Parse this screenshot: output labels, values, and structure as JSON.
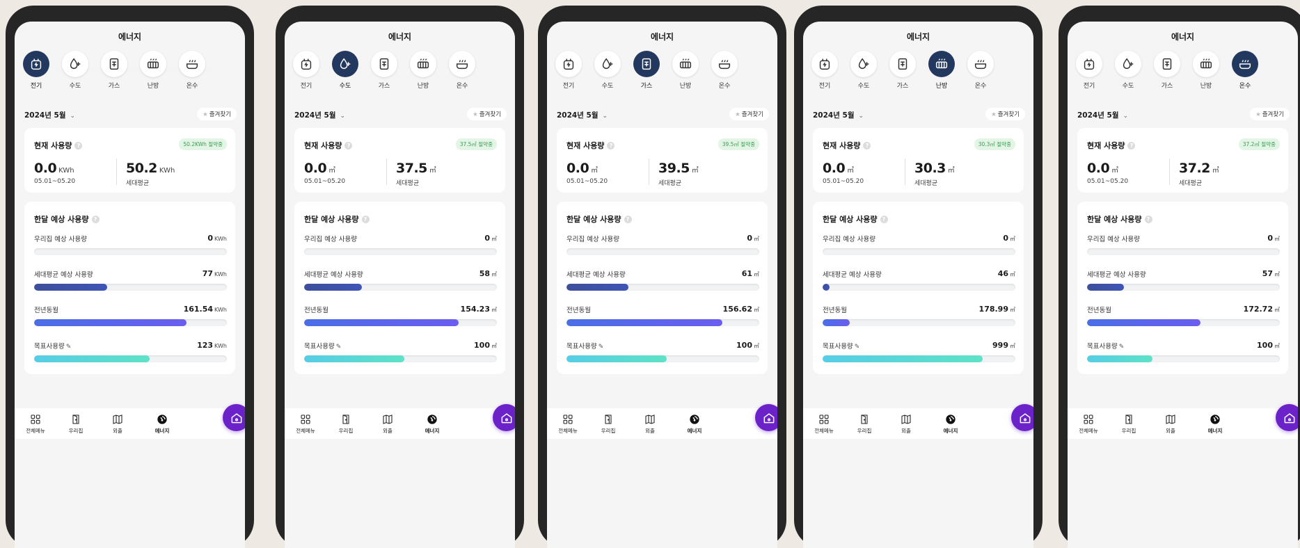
{
  "screens": [
    {
      "title": "에너지",
      "active_category": 0,
      "categories": [
        {
          "label": "전기",
          "icon": "electricity-icon"
        },
        {
          "label": "수도",
          "icon": "water-icon"
        },
        {
          "label": "가스",
          "icon": "gas-icon"
        },
        {
          "label": "난방",
          "icon": "heating-icon"
        },
        {
          "label": "온수",
          "icon": "hot-water-icon"
        }
      ],
      "month": "2024년 5월",
      "favorites_label": "즐겨찾기",
      "current": {
        "title": "현재 사용량",
        "badge": "50.2KWh 절약중",
        "my_value": "0.0",
        "my_unit": "KWh",
        "period": "05.01~05.20",
        "avg_value": "50.2",
        "avg_unit": "KWh",
        "avg_label": "세대평균"
      },
      "forecast": {
        "title": "한달 예상 사용량",
        "rows": [
          {
            "label": "우리집 예상 사용량",
            "value": "0",
            "unit": "KWh",
            "fill": 0.0,
            "kind": "mine"
          },
          {
            "label": "세대평균 예상 사용량",
            "value": "77",
            "unit": "KWh",
            "fill": 0.38,
            "kind": "avg"
          },
          {
            "label": "전년동월",
            "value": "161.54",
            "unit": "KWh",
            "fill": 0.79,
            "kind": "last"
          },
          {
            "label": "목표사용량",
            "value": "123",
            "unit": "KWh",
            "fill": 0.6,
            "kind": "goal"
          }
        ]
      },
      "tabs": [
        {
          "label": "전체메뉴",
          "icon": "grid-menu-icon"
        },
        {
          "label": "우리집",
          "icon": "door-icon"
        },
        {
          "label": "외출",
          "icon": "map-icon"
        },
        {
          "label": "에너지",
          "icon": "energy-gauge-icon"
        }
      ],
      "active_tab": 3
    },
    {
      "title": "에너지",
      "active_category": 1,
      "categories": [
        {
          "label": "전기",
          "icon": "electricity-icon"
        },
        {
          "label": "수도",
          "icon": "water-icon"
        },
        {
          "label": "가스",
          "icon": "gas-icon"
        },
        {
          "label": "난방",
          "icon": "heating-icon"
        },
        {
          "label": "온수",
          "icon": "hot-water-icon"
        }
      ],
      "month": "2024년 5월",
      "favorites_label": "즐겨찾기",
      "current": {
        "title": "현재 사용량",
        "badge": "37.5㎥ 절약중",
        "my_value": "0.0",
        "my_unit": "㎥",
        "period": "05.01~05.20",
        "avg_value": "37.5",
        "avg_unit": "㎥",
        "avg_label": "세대평균"
      },
      "forecast": {
        "title": "한달 예상 사용량",
        "rows": [
          {
            "label": "우리집 예상 사용량",
            "value": "0",
            "unit": "㎥",
            "fill": 0.0,
            "kind": "mine"
          },
          {
            "label": "세대평균 예상 사용량",
            "value": "58",
            "unit": "㎥",
            "fill": 0.3,
            "kind": "avg"
          },
          {
            "label": "전년동월",
            "value": "154.23",
            "unit": "㎥",
            "fill": 0.8,
            "kind": "last"
          },
          {
            "label": "목표사용량",
            "value": "100",
            "unit": "㎥",
            "fill": 0.52,
            "kind": "goal"
          }
        ]
      },
      "tabs": [
        {
          "label": "전체메뉴",
          "icon": "grid-menu-icon"
        },
        {
          "label": "우리집",
          "icon": "door-icon"
        },
        {
          "label": "외출",
          "icon": "map-icon"
        },
        {
          "label": "에너지",
          "icon": "energy-gauge-icon"
        }
      ],
      "active_tab": 3
    },
    {
      "title": "에너지",
      "active_category": 2,
      "categories": [
        {
          "label": "전기",
          "icon": "electricity-icon"
        },
        {
          "label": "수도",
          "icon": "water-icon"
        },
        {
          "label": "가스",
          "icon": "gas-icon"
        },
        {
          "label": "난방",
          "icon": "heating-icon"
        },
        {
          "label": "온수",
          "icon": "hot-water-icon"
        }
      ],
      "month": "2024년 5월",
      "favorites_label": "즐겨찾기",
      "current": {
        "title": "현재 사용량",
        "badge": "39.5㎥ 절약중",
        "my_value": "0.0",
        "my_unit": "㎥",
        "period": "05.01~05.20",
        "avg_value": "39.5",
        "avg_unit": "㎥",
        "avg_label": "세대평균"
      },
      "forecast": {
        "title": "한달 예상 사용량",
        "rows": [
          {
            "label": "우리집 예상 사용량",
            "value": "0",
            "unit": "㎥",
            "fill": 0.0,
            "kind": "mine"
          },
          {
            "label": "세대평균 예상 사용량",
            "value": "61",
            "unit": "㎥",
            "fill": 0.32,
            "kind": "avg"
          },
          {
            "label": "전년동월",
            "value": "156.62",
            "unit": "㎥",
            "fill": 0.81,
            "kind": "last"
          },
          {
            "label": "목표사용량",
            "value": "100",
            "unit": "㎥",
            "fill": 0.52,
            "kind": "goal"
          }
        ]
      },
      "tabs": [
        {
          "label": "전체메뉴",
          "icon": "grid-menu-icon"
        },
        {
          "label": "우리집",
          "icon": "door-icon"
        },
        {
          "label": "외출",
          "icon": "map-icon"
        },
        {
          "label": "에너지",
          "icon": "energy-gauge-icon"
        }
      ],
      "active_tab": 3
    },
    {
      "title": "에너지",
      "active_category": 3,
      "categories": [
        {
          "label": "전기",
          "icon": "electricity-icon"
        },
        {
          "label": "수도",
          "icon": "water-icon"
        },
        {
          "label": "가스",
          "icon": "gas-icon"
        },
        {
          "label": "난방",
          "icon": "heating-icon"
        },
        {
          "label": "온수",
          "icon": "hot-water-icon"
        }
      ],
      "month": "2024년 5월",
      "favorites_label": "즐겨찾기",
      "current": {
        "title": "현재 사용량",
        "badge": "30.3㎥ 절약중",
        "my_value": "0.0",
        "my_unit": "㎥",
        "period": "05.01~05.20",
        "avg_value": "30.3",
        "avg_unit": "㎥",
        "avg_label": "세대평균"
      },
      "forecast": {
        "title": "한달 예상 사용량",
        "rows": [
          {
            "label": "우리집 예상 사용량",
            "value": "0",
            "unit": "㎥",
            "fill": 0.0,
            "kind": "mine"
          },
          {
            "label": "세대평균 예상 사용량",
            "value": "46",
            "unit": "㎥",
            "fill": 0.03,
            "kind": "avg"
          },
          {
            "label": "전년동월",
            "value": "178.99",
            "unit": "㎥",
            "fill": 0.14,
            "kind": "last"
          },
          {
            "label": "목표사용량",
            "value": "999",
            "unit": "㎥",
            "fill": 0.83,
            "kind": "goal"
          }
        ]
      },
      "tabs": [
        {
          "label": "전체메뉴",
          "icon": "grid-menu-icon"
        },
        {
          "label": "우리집",
          "icon": "door-icon"
        },
        {
          "label": "외출",
          "icon": "map-icon"
        },
        {
          "label": "에너지",
          "icon": "energy-gauge-icon"
        }
      ],
      "active_tab": 3
    },
    {
      "title": "에너지",
      "active_category": 4,
      "categories": [
        {
          "label": "전기",
          "icon": "electricity-icon"
        },
        {
          "label": "수도",
          "icon": "water-icon"
        },
        {
          "label": "가스",
          "icon": "gas-icon"
        },
        {
          "label": "난방",
          "icon": "heating-icon"
        },
        {
          "label": "온수",
          "icon": "hot-water-icon"
        }
      ],
      "month": "2024년 5월",
      "favorites_label": "즐겨찾기",
      "current": {
        "title": "현재 사용량",
        "badge": "37.2㎥ 절약중",
        "my_value": "0.0",
        "my_unit": "㎥",
        "period": "05.01~05.20",
        "avg_value": "37.2",
        "avg_unit": "㎥",
        "avg_label": "세대평균"
      },
      "forecast": {
        "title": "한달 예상 사용량",
        "rows": [
          {
            "label": "우리집 예상 사용량",
            "value": "0",
            "unit": "㎥",
            "fill": 0.0,
            "kind": "mine"
          },
          {
            "label": "세대평균 예상 사용량",
            "value": "57",
            "unit": "㎥",
            "fill": 0.19,
            "kind": "avg"
          },
          {
            "label": "전년동월",
            "value": "172.72",
            "unit": "㎥",
            "fill": 0.59,
            "kind": "last"
          },
          {
            "label": "목표사용량",
            "value": "100",
            "unit": "㎥",
            "fill": 0.34,
            "kind": "goal"
          }
        ]
      },
      "tabs": [
        {
          "label": "전체메뉴",
          "icon": "grid-menu-icon"
        },
        {
          "label": "우리집",
          "icon": "door-icon"
        },
        {
          "label": "외출",
          "icon": "map-icon"
        },
        {
          "label": "에너지",
          "icon": "energy-gauge-icon"
        }
      ],
      "active_tab": 3
    }
  ],
  "colors": {
    "active_category": "#23385e",
    "badge_bg": "#e3f6e6",
    "badge_text": "#3a9b52",
    "home_button": "#6c22c9",
    "avg_bar": "#3f55b6",
    "last_year_bar": "#5a66ec",
    "goal_bar": "#5ad8d6"
  }
}
